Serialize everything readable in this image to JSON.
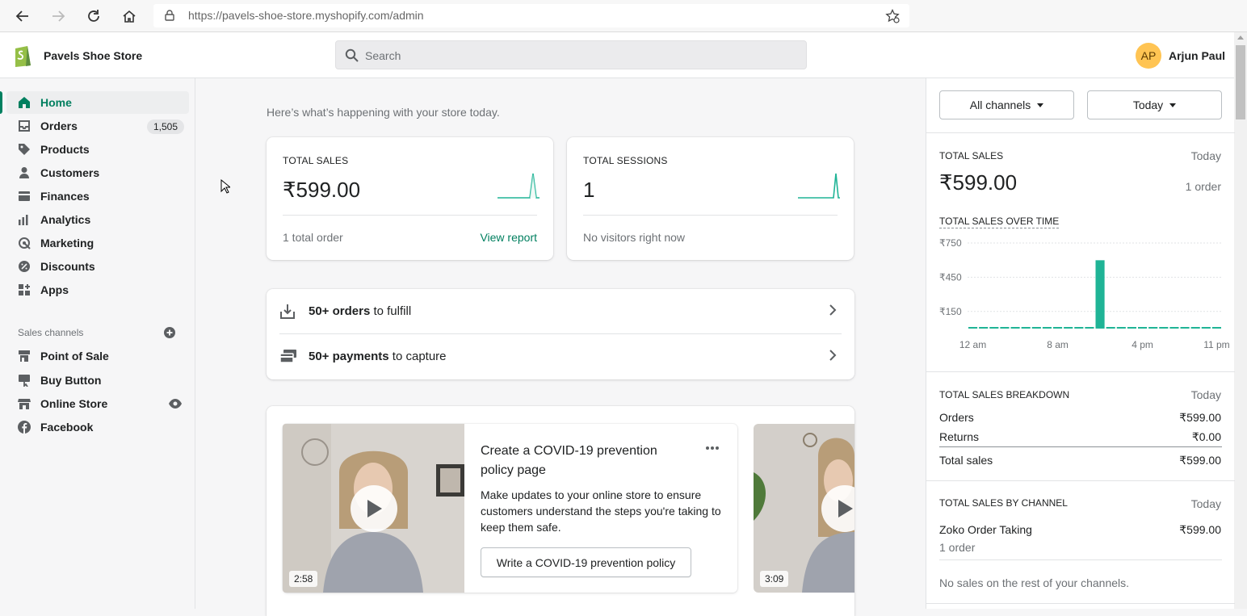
{
  "browser": {
    "url_base": "https://pavels-shoe-store.myshopify.com",
    "url_path": "/admin"
  },
  "header": {
    "store_name": "Pavels Shoe Store",
    "search_placeholder": "Search",
    "avatar_initials": "AP",
    "user_name": "Arjun Paul"
  },
  "sidebar": {
    "items": [
      {
        "label": "Home",
        "icon": "home-icon"
      },
      {
        "label": "Orders",
        "icon": "orders-icon",
        "badge": "1,505"
      },
      {
        "label": "Products",
        "icon": "tag-icon"
      },
      {
        "label": "Customers",
        "icon": "person-icon"
      },
      {
        "label": "Finances",
        "icon": "finances-icon"
      },
      {
        "label": "Analytics",
        "icon": "bar-chart-icon"
      },
      {
        "label": "Marketing",
        "icon": "target-icon"
      },
      {
        "label": "Discounts",
        "icon": "discount-icon"
      },
      {
        "label": "Apps",
        "icon": "apps-icon"
      }
    ],
    "sales_channels_title": "Sales channels",
    "channels": [
      {
        "label": "Point of Sale",
        "icon": "pos-icon"
      },
      {
        "label": "Buy Button",
        "icon": "buy-button-icon"
      },
      {
        "label": "Online Store",
        "icon": "store-icon"
      },
      {
        "label": "Facebook",
        "icon": "facebook-icon"
      }
    ]
  },
  "main": {
    "intro": "Here’s what’s happening with your store today.",
    "total_sales": {
      "label": "TOTAL SALES",
      "value": "₹599.00",
      "foot": "1 total order",
      "link": "View report"
    },
    "total_sessions": {
      "label": "TOTAL SESSIONS",
      "value": "1",
      "foot": "No visitors right now"
    },
    "tasks": [
      {
        "bold": "50+ orders",
        "rest": " to fulfill",
        "icon": "fulfill-icon"
      },
      {
        "bold": "50+ payments",
        "rest": " to capture",
        "icon": "payment-icon"
      }
    ],
    "promo": {
      "title": "Create a COVID-19 prevention policy page",
      "body": "Make updates to your online store to ensure customers understand the steps you're taking to keep them safe.",
      "button": "Write a COVID-19 prevention policy",
      "duration_1": "2:58",
      "duration_2": "3:09"
    }
  },
  "right_panel": {
    "channel_filter": "All channels",
    "date_filter": "Today",
    "total_sales": {
      "label": "TOTAL SALES",
      "period": "Today",
      "value": "₹599.00",
      "orders": "1 order"
    },
    "over_time": {
      "label": "TOTAL SALES OVER TIME",
      "y_ticks": [
        "₹750",
        "₹450",
        "₹150"
      ],
      "x_ticks": [
        "12 am",
        "8 am",
        "4 pm",
        "11 pm"
      ]
    },
    "breakdown": {
      "label": "TOTAL SALES BREAKDOWN",
      "period": "Today",
      "rows": [
        {
          "label": "Orders",
          "value": "₹599.00"
        },
        {
          "label": "Returns",
          "value": "₹0.00"
        },
        {
          "label": "Total sales",
          "value": "₹599.00"
        }
      ]
    },
    "by_channel": {
      "label": "TOTAL SALES BY CHANNEL",
      "period": "Today",
      "channel": "Zoko Order Taking",
      "value": "₹599.00",
      "orders": "1 order",
      "note": "No sales on the rest of your channels."
    }
  },
  "chart_data": {
    "type": "bar",
    "title": "TOTAL SALES OVER TIME",
    "x_ticks": [
      "12 am",
      "8 am",
      "4 pm",
      "11 pm"
    ],
    "y_ticks": [
      "₹750",
      "₹450",
      "₹150"
    ],
    "hours": [
      0,
      1,
      2,
      3,
      4,
      5,
      6,
      7,
      8,
      9,
      10,
      11,
      12,
      13,
      14,
      15,
      16,
      17,
      18,
      19,
      20,
      21,
      22,
      23
    ],
    "values": [
      0,
      0,
      0,
      0,
      0,
      0,
      0,
      0,
      0,
      0,
      0,
      0,
      599,
      0,
      0,
      0,
      0,
      0,
      0,
      0,
      0,
      0,
      0,
      0
    ],
    "ylim": [
      0,
      750
    ],
    "color": "#1fb496"
  },
  "colors": {
    "accent": "#008060",
    "chart": "#1fb496"
  }
}
